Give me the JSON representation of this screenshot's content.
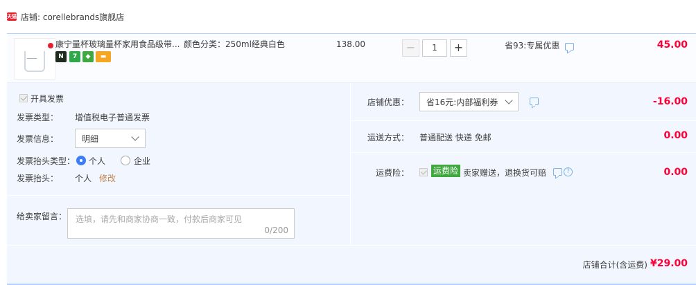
{
  "shop": {
    "badge": "天猫",
    "name": "店铺: corellebrands旗舰店"
  },
  "item": {
    "title": "康宁量杯玻璃量杯家用食品级带...",
    "sku": "颜色分类：250ml经典白色",
    "icons": [
      "cat-badge-icon",
      "seven-day-return-icon",
      "shield-icon",
      "credit-card-icon"
    ],
    "price": "138.00",
    "quantity": "1",
    "discount": "省93:专属优惠",
    "total": "45.00"
  },
  "invoice": {
    "issue_label": "开具发票",
    "type_label": "发票类型：",
    "type_value": "增值税电子普通发票",
    "info_label": "发票信息：",
    "info_value": "明细",
    "header_type_label": "发票抬头类型：",
    "options": [
      "个人",
      "企业"
    ],
    "selected_option": "个人",
    "header_label": "发票抬头：",
    "header_value": "个人",
    "modify_label": "修改"
  },
  "note": {
    "label": "给卖家留言：",
    "placeholder": "选填，请先和商家协商一致，付款后商家可见",
    "count": "0/200"
  },
  "shop_discount": {
    "label": "店铺优惠：",
    "value": "省16元:内部福利券",
    "amount": "-16.00"
  },
  "delivery": {
    "label": "运送方式：",
    "value": "普通配送 快递 免邮",
    "amount": "0.00"
  },
  "insurance": {
    "label": "运费险：",
    "tag": "运费险",
    "value": "卖家赠送，退换货可赔",
    "amount": "0.00"
  },
  "footer": {
    "label": "店铺合计(含运费)",
    "amount": "¥29.00"
  },
  "colors": {
    "price_red": "#ff0036",
    "panel_bg": "#f2f7ff",
    "accent_blue": "#3c7ef3",
    "link_brown": "#c1824a",
    "tag_green": "#3fa940"
  }
}
